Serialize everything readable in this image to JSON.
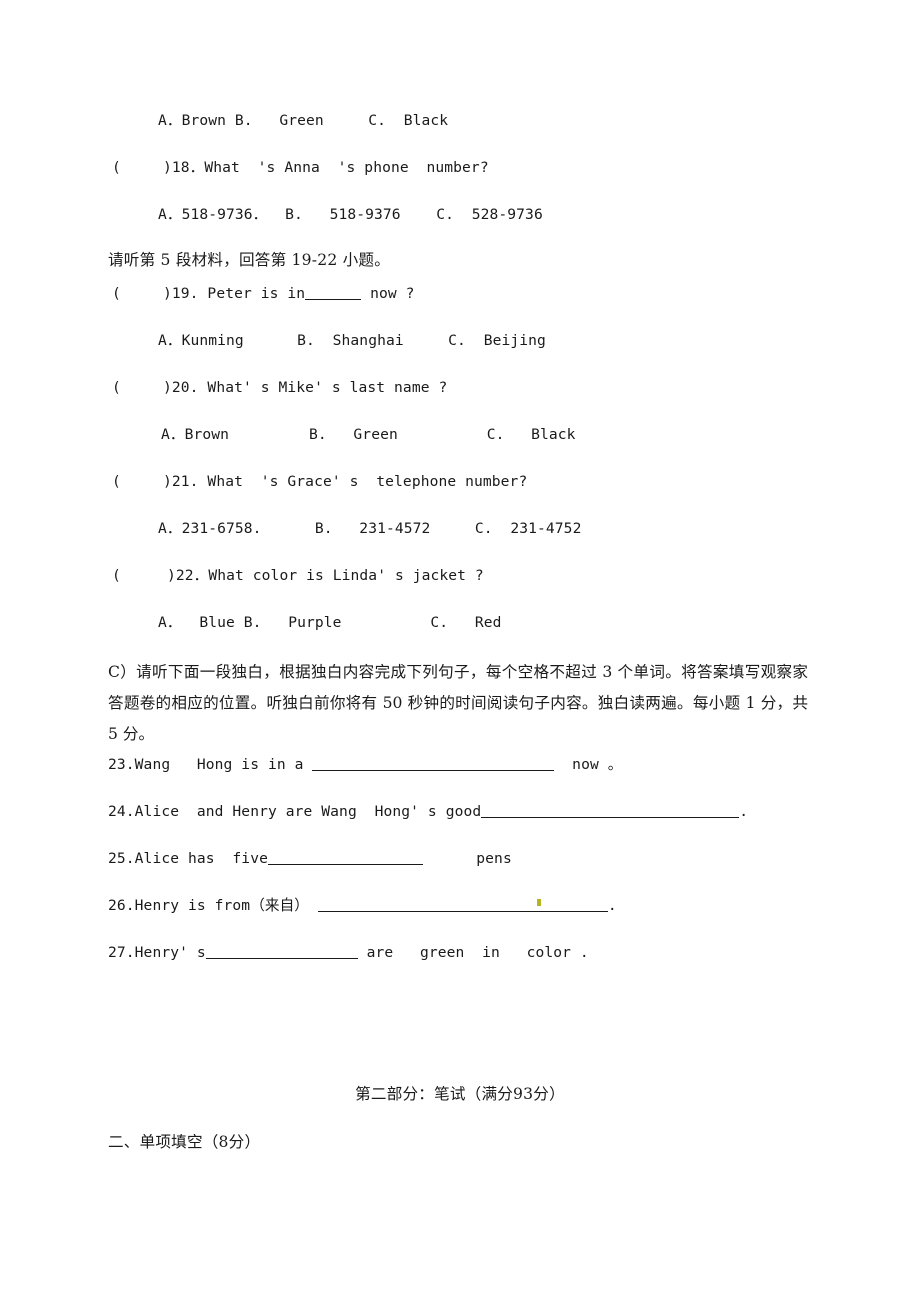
{
  "document": {
    "type": "english-exam-paper",
    "language": "zh-en"
  },
  "listening": {
    "q17_options": "A．Brown B.   Green     C.  Black",
    "q18": {
      "marker_open": "(",
      "marker_close": ")",
      "text": ")18．What  's Anna  's phone  number?",
      "options": "A．518-9736．  B.   518-9376    C.  528-9736"
    },
    "section5_instruction": "请听第 5 段材料，回答第 19-22 小题。",
    "q19": {
      "prefix": ")19. Peter is in",
      "suffix": " now ?",
      "options": "A．Kunming      B.  Shanghai     C.  Beijing"
    },
    "q20": {
      "text": ")20. What' s Mike' s last name ?",
      "options": "A．Brown         B.   Green          C.   Black"
    },
    "q21": {
      "text": ")21. What  's Grace' s  telephone number?",
      "options": "A．231-6758.      B.   231-4572     C.  231-4752"
    },
    "q22": {
      "text": ")22．What color is Linda' s jacket ?",
      "options": "A．  Blue B.   Purple          C.   Red"
    }
  },
  "part_c": {
    "instruction": "C）请听下面一段独白，根据独白内容完成下列句子，每个空格不超过 3 个单词。将答案填写观察家答题卷的相应的位置。听独白前你将有 50 秒钟的时间阅读句子内容。独白读两遍。每小题 1 分，共 5 分。",
    "items": [
      {
        "number": "23.",
        "before": "Wang   Hong is in a ",
        "after": "  now 。"
      },
      {
        "number": "24.",
        "before": "Alice  and Henry are Wang  Hong' s good",
        "after": "."
      },
      {
        "number": "25.",
        "before": "Alice has  five",
        "after": "      pens"
      },
      {
        "number": "26.",
        "before": "Henry is from（来自） ",
        "after": "."
      },
      {
        "number": "27.",
        "before": "Henry' s",
        "after": " are   green  in   color ."
      }
    ]
  },
  "part_two": {
    "heading": "第二部分：笔试（满分93分）",
    "section_heading": "二、单项填空（8分）"
  }
}
